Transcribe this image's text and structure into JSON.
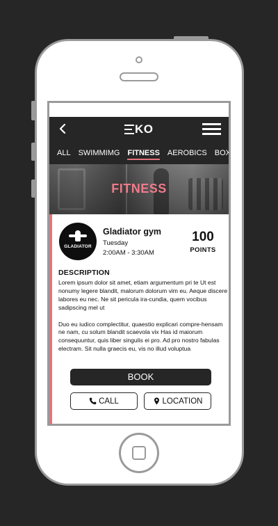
{
  "app": {
    "logo_text": "KO"
  },
  "tabs": [
    {
      "label": "ALL"
    },
    {
      "label": "SWIMMIMG"
    },
    {
      "label": "FITNESS",
      "active": true
    },
    {
      "label": "AEROBICS"
    },
    {
      "label": "BOXING"
    }
  ],
  "banner": {
    "title": "FITNESS"
  },
  "gym": {
    "logo_text": "GLADIATOR",
    "name": "Gladiator gym",
    "day": "Tuesday",
    "time": "2:00AM - 3:30AM",
    "points": "100",
    "points_label": "POINTS"
  },
  "description": {
    "title": "DESCRIPTION",
    "body": "Lorem ipsum dolor sit amet, etiam argumentum pri te Ut est nonumy legere blandit, malorum dolorum vim eu. Aeque discere labores eu nec. Ne sit pericula ira-cundia, quem vocibus sadipscing mel ut\n\nDuo eu iudico complectitur, quaestio explicari compre-hensam ne nam, cu solum blandit scaevola vix Has id maiorum consequuntur, quis liber singulis ei pro. Ad pro nostro fabulas electram. Sit nulla graecis eu, vis no illud voluptua"
  },
  "actions": {
    "book_label": "BOOK",
    "call_label": "CALL",
    "location_label": "LOCATION"
  },
  "colors": {
    "accent": "#e8717e",
    "dark": "#262626",
    "frame": "#9a9a9a"
  },
  "icons": [
    "back-icon",
    "menu-icon",
    "phone-icon",
    "location-pin-icon"
  ]
}
